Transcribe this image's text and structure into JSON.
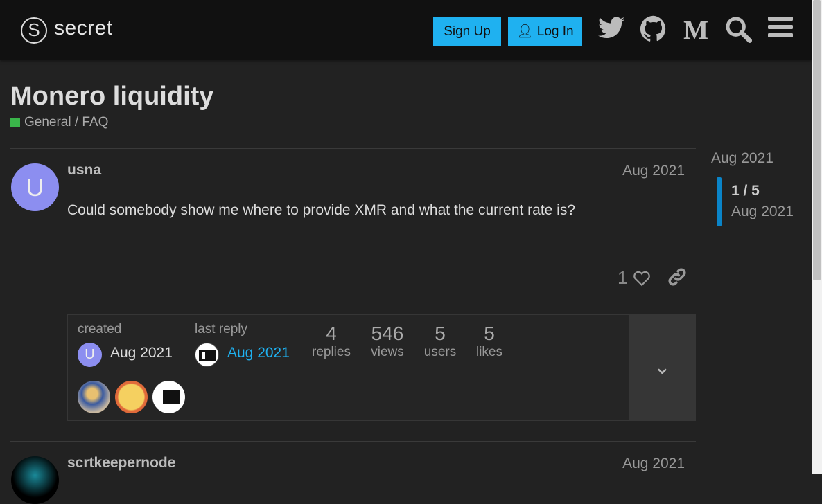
{
  "header": {
    "logo_text": "secret",
    "signup": "Sign Up",
    "login": "Log In"
  },
  "topic": {
    "title": "Monero liquidity",
    "category": "General / FAQ",
    "category_color": "#3ab54a"
  },
  "posts": [
    {
      "username": "usna",
      "avatar_letter": "U",
      "date": "Aug 2021",
      "body": "Could somebody show me where to provide XMR and what the current rate is?",
      "likes": "1"
    },
    {
      "username": "scrtkeepernode",
      "date": "Aug 2021"
    }
  ],
  "topic_map": {
    "created_label": "created",
    "created_date": "Aug 2021",
    "created_avatar": "U",
    "last_reply_label": "last reply",
    "last_reply_date": "Aug 2021",
    "stats": [
      {
        "n": "4",
        "l": "replies"
      },
      {
        "n": "546",
        "l": "views"
      },
      {
        "n": "5",
        "l": "users"
      },
      {
        "n": "5",
        "l": "likes"
      }
    ]
  },
  "timeline": {
    "start": "Aug 2021",
    "position": "1 / 5",
    "current_date": "Aug 2021",
    "accent": "#0a84c8"
  }
}
